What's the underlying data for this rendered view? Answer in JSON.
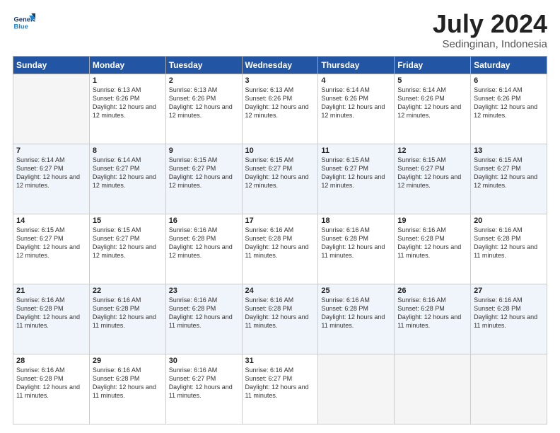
{
  "header": {
    "logo_line1": "General",
    "logo_line2": "Blue",
    "month": "July 2024",
    "location": "Sedinginan, Indonesia"
  },
  "days_of_week": [
    "Sunday",
    "Monday",
    "Tuesday",
    "Wednesday",
    "Thursday",
    "Friday",
    "Saturday"
  ],
  "weeks": [
    [
      {
        "day": "",
        "empty": true
      },
      {
        "day": "1",
        "sunrise": "6:13 AM",
        "sunset": "6:26 PM",
        "daylight": "12 hours and 12 minutes."
      },
      {
        "day": "2",
        "sunrise": "6:13 AM",
        "sunset": "6:26 PM",
        "daylight": "12 hours and 12 minutes."
      },
      {
        "day": "3",
        "sunrise": "6:13 AM",
        "sunset": "6:26 PM",
        "daylight": "12 hours and 12 minutes."
      },
      {
        "day": "4",
        "sunrise": "6:14 AM",
        "sunset": "6:26 PM",
        "daylight": "12 hours and 12 minutes."
      },
      {
        "day": "5",
        "sunrise": "6:14 AM",
        "sunset": "6:26 PM",
        "daylight": "12 hours and 12 minutes."
      },
      {
        "day": "6",
        "sunrise": "6:14 AM",
        "sunset": "6:26 PM",
        "daylight": "12 hours and 12 minutes."
      }
    ],
    [
      {
        "day": "7",
        "sunrise": "6:14 AM",
        "sunset": "6:27 PM",
        "daylight": "12 hours and 12 minutes."
      },
      {
        "day": "8",
        "sunrise": "6:14 AM",
        "sunset": "6:27 PM",
        "daylight": "12 hours and 12 minutes."
      },
      {
        "day": "9",
        "sunrise": "6:15 AM",
        "sunset": "6:27 PM",
        "daylight": "12 hours and 12 minutes."
      },
      {
        "day": "10",
        "sunrise": "6:15 AM",
        "sunset": "6:27 PM",
        "daylight": "12 hours and 12 minutes."
      },
      {
        "day": "11",
        "sunrise": "6:15 AM",
        "sunset": "6:27 PM",
        "daylight": "12 hours and 12 minutes."
      },
      {
        "day": "12",
        "sunrise": "6:15 AM",
        "sunset": "6:27 PM",
        "daylight": "12 hours and 12 minutes."
      },
      {
        "day": "13",
        "sunrise": "6:15 AM",
        "sunset": "6:27 PM",
        "daylight": "12 hours and 12 minutes."
      }
    ],
    [
      {
        "day": "14",
        "sunrise": "6:15 AM",
        "sunset": "6:27 PM",
        "daylight": "12 hours and 12 minutes."
      },
      {
        "day": "15",
        "sunrise": "6:15 AM",
        "sunset": "6:27 PM",
        "daylight": "12 hours and 12 minutes."
      },
      {
        "day": "16",
        "sunrise": "6:16 AM",
        "sunset": "6:28 PM",
        "daylight": "12 hours and 12 minutes."
      },
      {
        "day": "17",
        "sunrise": "6:16 AM",
        "sunset": "6:28 PM",
        "daylight": "12 hours and 11 minutes."
      },
      {
        "day": "18",
        "sunrise": "6:16 AM",
        "sunset": "6:28 PM",
        "daylight": "12 hours and 11 minutes."
      },
      {
        "day": "19",
        "sunrise": "6:16 AM",
        "sunset": "6:28 PM",
        "daylight": "12 hours and 11 minutes."
      },
      {
        "day": "20",
        "sunrise": "6:16 AM",
        "sunset": "6:28 PM",
        "daylight": "12 hours and 11 minutes."
      }
    ],
    [
      {
        "day": "21",
        "sunrise": "6:16 AM",
        "sunset": "6:28 PM",
        "daylight": "12 hours and 11 minutes."
      },
      {
        "day": "22",
        "sunrise": "6:16 AM",
        "sunset": "6:28 PM",
        "daylight": "12 hours and 11 minutes."
      },
      {
        "day": "23",
        "sunrise": "6:16 AM",
        "sunset": "6:28 PM",
        "daylight": "12 hours and 11 minutes."
      },
      {
        "day": "24",
        "sunrise": "6:16 AM",
        "sunset": "6:28 PM",
        "daylight": "12 hours and 11 minutes."
      },
      {
        "day": "25",
        "sunrise": "6:16 AM",
        "sunset": "6:28 PM",
        "daylight": "12 hours and 11 minutes."
      },
      {
        "day": "26",
        "sunrise": "6:16 AM",
        "sunset": "6:28 PM",
        "daylight": "12 hours and 11 minutes."
      },
      {
        "day": "27",
        "sunrise": "6:16 AM",
        "sunset": "6:28 PM",
        "daylight": "12 hours and 11 minutes."
      }
    ],
    [
      {
        "day": "28",
        "sunrise": "6:16 AM",
        "sunset": "6:28 PM",
        "daylight": "12 hours and 11 minutes."
      },
      {
        "day": "29",
        "sunrise": "6:16 AM",
        "sunset": "6:28 PM",
        "daylight": "12 hours and 11 minutes."
      },
      {
        "day": "30",
        "sunrise": "6:16 AM",
        "sunset": "6:27 PM",
        "daylight": "12 hours and 11 minutes."
      },
      {
        "day": "31",
        "sunrise": "6:16 AM",
        "sunset": "6:27 PM",
        "daylight": "12 hours and 11 minutes."
      },
      {
        "day": "",
        "empty": true
      },
      {
        "day": "",
        "empty": true
      },
      {
        "day": "",
        "empty": true
      }
    ]
  ]
}
